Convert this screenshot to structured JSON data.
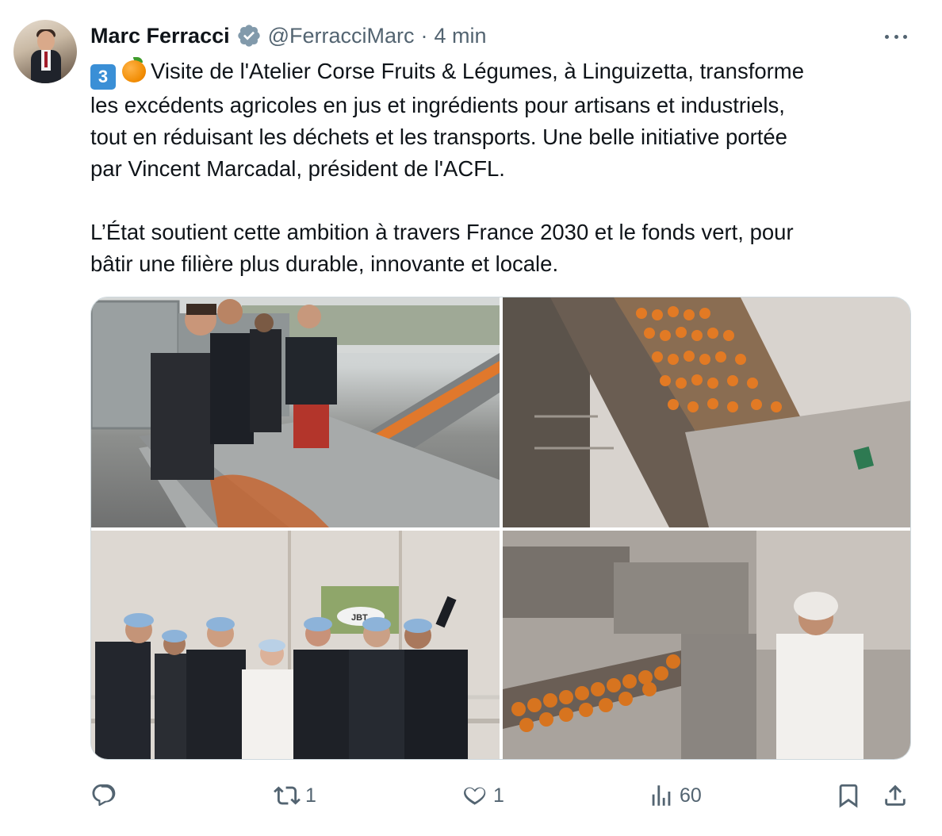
{
  "author": {
    "name": "Marc Ferracci",
    "handle": "@FerracciMarc",
    "separator": "·",
    "time": "4 min",
    "verified_icon": "verified-badge-icon"
  },
  "tweet": {
    "lines": [
      "Visite de l'Atelier Corse Fruits & Légumes, à Linguizetta, transforme",
      "les excédents agricoles en jus et ingrédients pour artisans et industriels,",
      "tout en réduisant les déchets et les transports. Une belle initiative portée",
      "par Vincent Marcadal, président de l'ACFL.",
      "L’État soutient cette ambition à travers France 2030 et le fonds vert, pour",
      "bâtir une filière plus durable, innovante et locale."
    ],
    "emoji_keycap": "3",
    "emoji_fruit": "orange-emoji"
  },
  "media": {
    "photo3_sign": "JBT"
  },
  "actions": {
    "reply_count": "",
    "retweet_count": "1",
    "like_count": "1",
    "views_count": "60"
  },
  "colors": {
    "text_primary": "#0f1419",
    "text_secondary": "#536471",
    "verified_blue": "#829aab",
    "border": "#cfd9de"
  }
}
